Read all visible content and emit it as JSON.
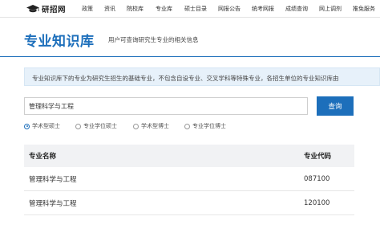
{
  "nav": {
    "logo_text": "研招网",
    "items": [
      "政策",
      "资讯",
      "院校库",
      "专业库",
      "硕士目录",
      "网报公告",
      "统考网报",
      "成绩查询",
      "网上调剂",
      "推免服务"
    ]
  },
  "header": {
    "title": "专业知识库",
    "subtitle": "用户可查询研究生专业的相关信息"
  },
  "notice": {
    "text": "专业知识库下的专业为研究生招生的基础专业，不包含自设专业、交叉学科等特殊专业，各招生单位的专业知识库由"
  },
  "search": {
    "value": "管理科学与工程",
    "button_label": "查询"
  },
  "degree_options": [
    {
      "label": "学术型硕士",
      "selected": true
    },
    {
      "label": "专业学位硕士",
      "selected": false
    },
    {
      "label": "学术型博士",
      "selected": false
    },
    {
      "label": "专业学位博士",
      "selected": false
    }
  ],
  "table": {
    "headers": [
      "专业名称",
      "专业代码"
    ],
    "rows": [
      [
        "管理科学与工程",
        "087100"
      ],
      [
        "管理科学与工程",
        "120100"
      ]
    ]
  },
  "colors": {
    "accent": "#1d6fbb",
    "notice_bg": "#e7f1fa",
    "table_header_bg": "#f1f2f4"
  }
}
